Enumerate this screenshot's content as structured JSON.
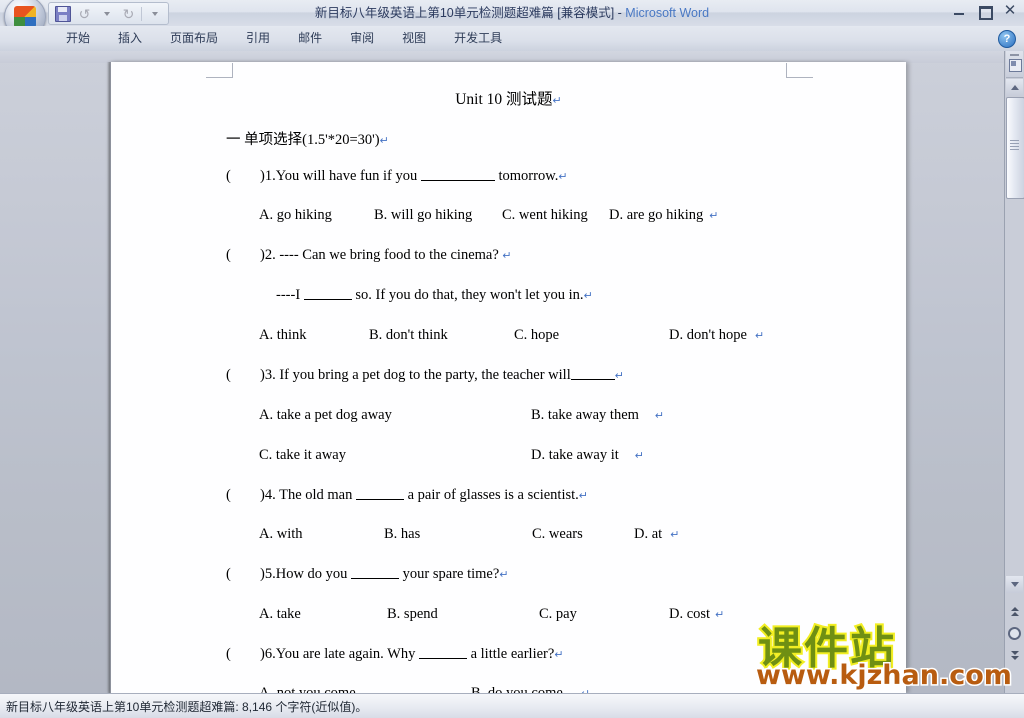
{
  "window": {
    "title": "新目标八年级英语上第10单元检测题超难篇 [兼容模式]",
    "separator": " - ",
    "app_name": "Microsoft Word",
    "minimize_label": "最小化",
    "restore_label": "还原",
    "close_label": "关闭",
    "help_label": "?"
  },
  "quick_access": {
    "office_button": "Office 按钮",
    "save": "保存",
    "undo": "撤消",
    "redo": "恢复",
    "customize": "自定义快速访问工具栏"
  },
  "ribbon": {
    "tabs": [
      {
        "label": "开始",
        "active": false
      },
      {
        "label": "插入",
        "active": false
      },
      {
        "label": "页面布局",
        "active": false
      },
      {
        "label": "引用",
        "active": false
      },
      {
        "label": "邮件",
        "active": false
      },
      {
        "label": "审阅",
        "active": false
      },
      {
        "label": "视图",
        "active": false
      },
      {
        "label": "开发工具",
        "active": false
      }
    ]
  },
  "document": {
    "title": "Unit 10  测试题",
    "section_heading": "一  单项选择(1.5'*20=30')",
    "paragraph_mark": "↵",
    "questions": [
      {
        "number": "1",
        "paren": "(",
        "paren_close": ")",
        "stem_before": "1.You will have fun if you ",
        "stem_after": " tomorrow.",
        "options_layout": "row",
        "options": [
          "A. go hiking",
          "B. will go hiking",
          "C. went hiking",
          "D. are go hiking"
        ]
      },
      {
        "number": "2",
        "paren": "(",
        "paren_close": ")",
        "stem_before": "2. ---- Can we bring food to the cinema? ",
        "stem_after": "",
        "continuation_before": "----I ",
        "continuation_after": " so. If you do that, they won't let you in.",
        "options_layout": "row",
        "options": [
          "A. think",
          "B. don't think",
          "C.   hope",
          "D. don't hope"
        ]
      },
      {
        "number": "3",
        "paren": "(",
        "paren_close": ")",
        "stem_before": "3. If you bring a pet dog to the party, the teacher will",
        "stem_after": "",
        "options_layout": "grid",
        "options": [
          "A. take a pet dog away",
          "B. take away them",
          "C. take it away",
          "D. take away it"
        ]
      },
      {
        "number": "4",
        "paren": "(",
        "paren_close": ")",
        "stem_before": "4. The old man ",
        "stem_after": " a pair of glasses  is a scientist.",
        "options_layout": "row",
        "options": [
          "A. with",
          "B. has",
          "C. wears",
          "D. at"
        ]
      },
      {
        "number": "5",
        "paren": "(",
        "paren_close": ")",
        "stem_before": "5.How do you ",
        "stem_after": " your spare time?",
        "options_layout": "row",
        "options": [
          "A. take",
          "B. spend",
          "C. pay",
          "D. cost"
        ]
      },
      {
        "number": "6",
        "paren": "(",
        "paren_close": ")",
        "stem_before": "6.You are late again. Why ",
        "stem_after": " a little earlier?",
        "options_layout": "row",
        "options": [
          "A. not you come",
          "B. do you come"
        ]
      }
    ]
  },
  "statusbar": {
    "text": "新目标八年级英语上第10单元检测题超难篇: 8,146 个字符(近似值)。"
  },
  "scrollbar": {
    "split_label": "拆分窗口",
    "up_label": "向上滚动",
    "down_label": "向下滚动",
    "prev_page_label": "上一页",
    "browse_object_label": "选择浏览对象",
    "next_page_label": "下一页"
  },
  "watermark": {
    "cn_text": "课件站",
    "url_text": "www.kjzhan.com",
    "cn_color": "#6f8f13",
    "cn_outline": "#f2ee22",
    "url_color": "#b85c10"
  }
}
